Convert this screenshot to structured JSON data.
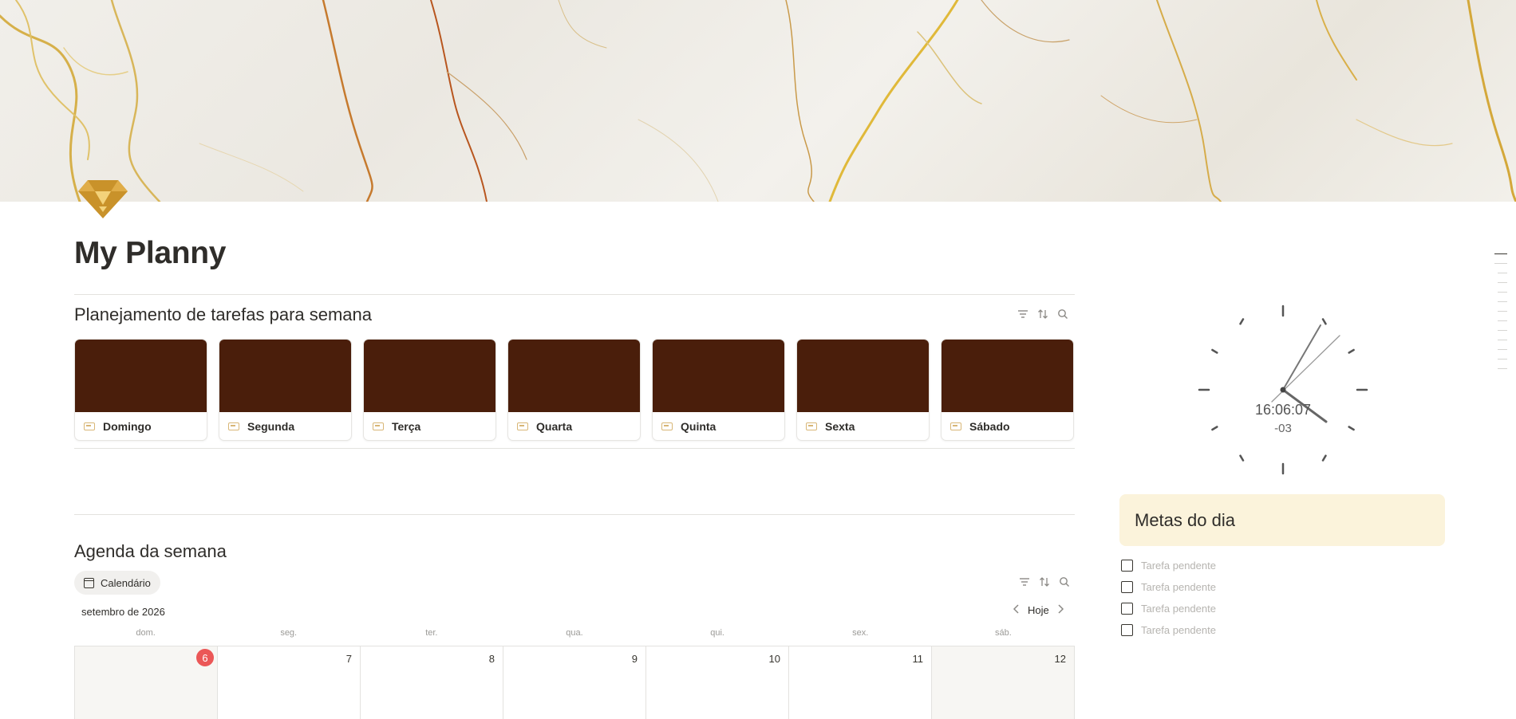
{
  "page": {
    "title": "My Planny"
  },
  "tasks_section": {
    "title": "Planejamento de tarefas para semana",
    "cards": [
      {
        "label": "Domingo"
      },
      {
        "label": "Segunda"
      },
      {
        "label": "Terça"
      },
      {
        "label": "Quarta"
      },
      {
        "label": "Quinta"
      },
      {
        "label": "Sexta"
      },
      {
        "label": "Sábado"
      }
    ],
    "card_cover_color": "#4a1e0b"
  },
  "agenda_section": {
    "title": "Agenda da semana",
    "view_label": "Calendário",
    "month_label": "setembro de 2026",
    "today_button": "Hoje",
    "weekdays": [
      "dom.",
      "seg.",
      "ter.",
      "qua.",
      "qui.",
      "sex.",
      "sáb."
    ],
    "days": [
      "6",
      "7",
      "8",
      "9",
      "10",
      "11",
      "12"
    ],
    "today_color": "#eb5757"
  },
  "clock": {
    "time": "16:06:07",
    "timezone": "-03"
  },
  "goals": {
    "title": "Metas do dia",
    "items": [
      {
        "placeholder": "Tarefa pendente"
      },
      {
        "placeholder": "Tarefa pendente"
      },
      {
        "placeholder": "Tarefa pendente"
      },
      {
        "placeholder": "Tarefa pendente"
      }
    ],
    "card_color": "#fbf3db"
  },
  "icons": {
    "page_icon": "gold-diamond-icon",
    "filter": "filter-icon",
    "sort": "sort-icon",
    "search": "search-icon",
    "calendar": "calendar-icon",
    "prev": "chevron-left-icon",
    "next": "chevron-right-icon",
    "card_page": "page-icon"
  },
  "colors": {
    "accent_gold": "#c9922a"
  }
}
